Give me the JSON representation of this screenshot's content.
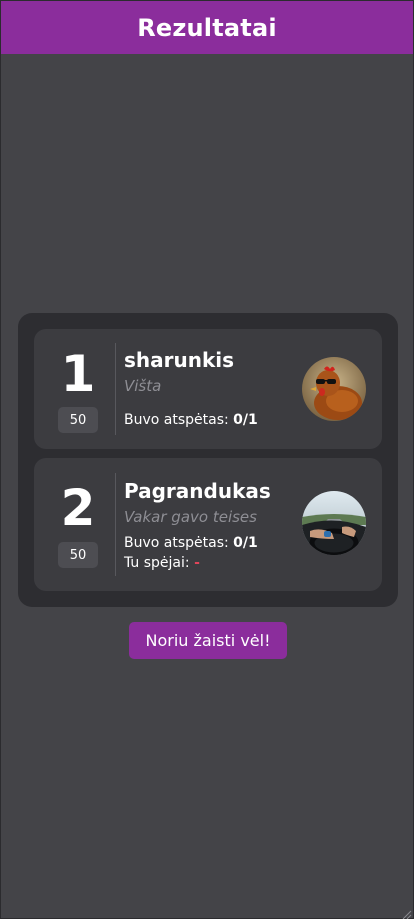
{
  "header": {
    "title": "Rezultatai"
  },
  "results": [
    {
      "rank": "1",
      "score": "50",
      "name": "sharunkis",
      "word": "Višta",
      "guessed_label": "Buvo atspėtas: ",
      "guessed_value": "0/1",
      "avatar_icon": "chicken-avatar"
    },
    {
      "rank": "2",
      "score": "50",
      "name": "Pagrandukas",
      "word": "Vakar gavo teises",
      "guessed_label": "Buvo atspėtas: ",
      "guessed_value": "0/1",
      "you_guessed_label": "Tu spėjai: ",
      "you_guessed_value": "-",
      "avatar_icon": "driving-avatar"
    }
  ],
  "actions": {
    "play_again_label": "Noriu žaisti vėl!"
  },
  "colors": {
    "accent": "#8b2d9c",
    "background": "#444448",
    "panel": "#2d2d31",
    "card": "#3c3c40",
    "muted_text": "#8e8e94",
    "negative": "#e0455a"
  }
}
